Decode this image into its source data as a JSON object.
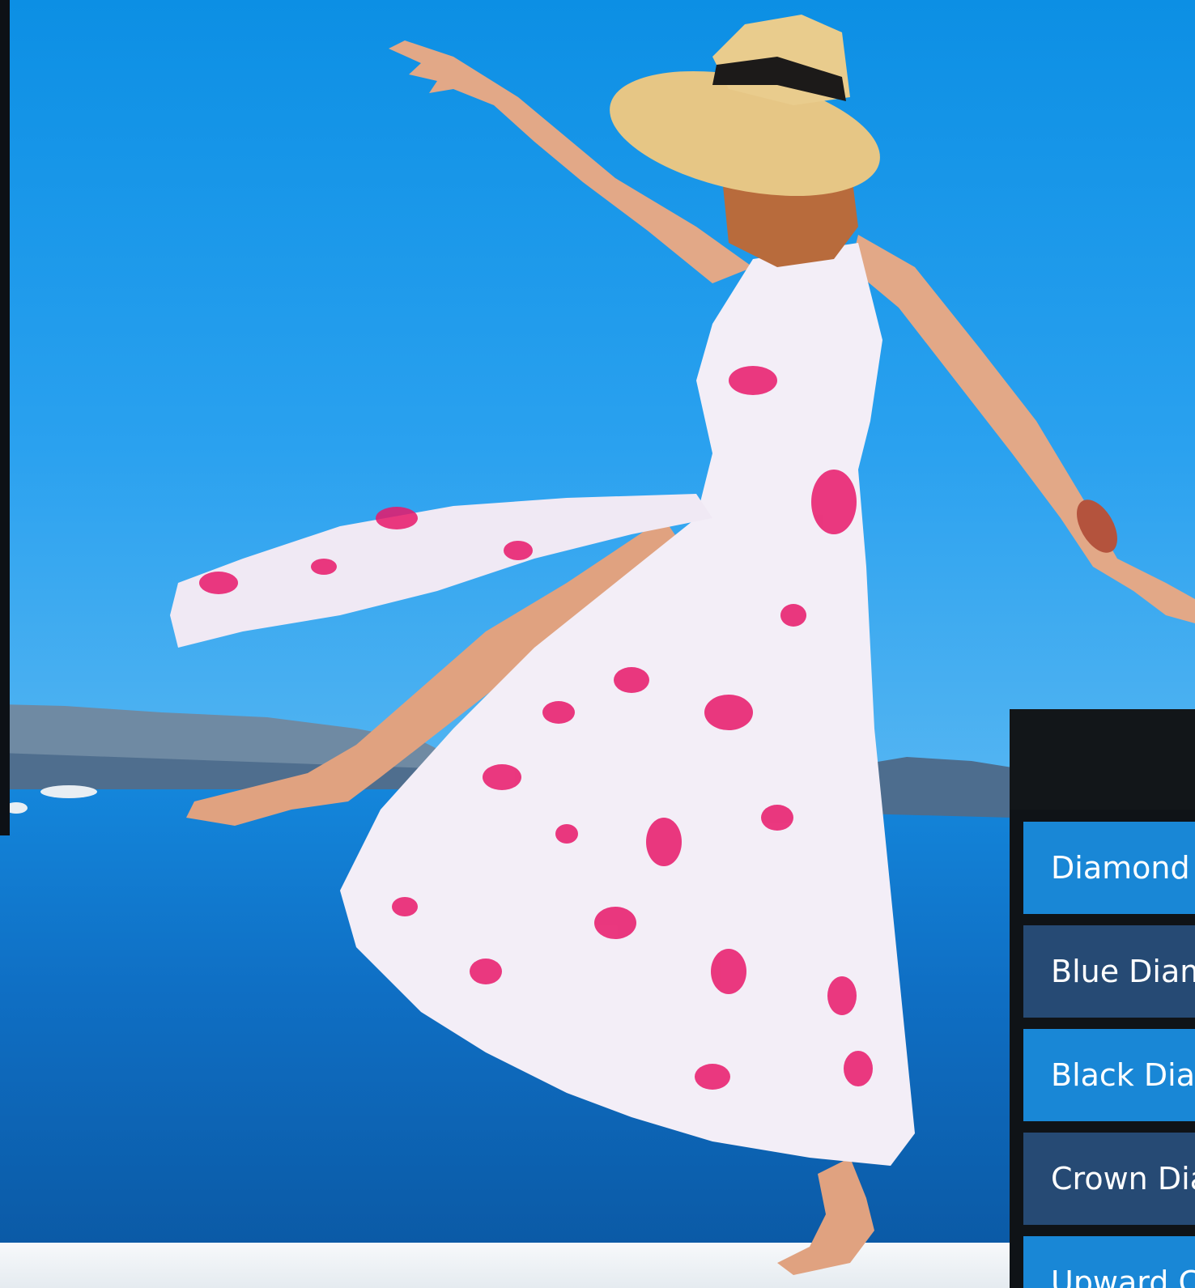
{
  "menu": {
    "items": [
      {
        "label": "Diamond"
      },
      {
        "label": "Blue Diam"
      },
      {
        "label": "Black Diar"
      },
      {
        "label": "Crown Dia"
      },
      {
        "label": "Upward C"
      }
    ]
  },
  "colors": {
    "menu_light": "#1987d6",
    "menu_dark": "#264a74",
    "panel_bg": "#0f1317"
  }
}
